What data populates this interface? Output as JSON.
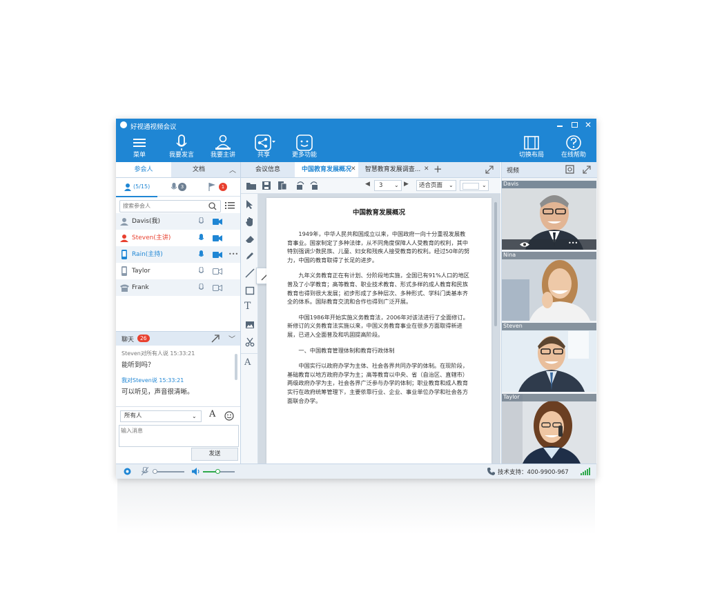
{
  "app": {
    "title": "好视通视频会议"
  },
  "toolbar": {
    "menu": "菜单",
    "speak": "我要发言",
    "host": "我要主讲",
    "share": "共享",
    "more": "更多功能",
    "layout": "切换布局",
    "help": "在线帮助"
  },
  "left": {
    "tabs": {
      "participants": "参会人",
      "docs": "文档"
    },
    "count": "(5/15)",
    "mic_badge": "3",
    "flag_badge": "1",
    "search": {
      "placeholder": "搜索参会人"
    },
    "participants": [
      {
        "name": "Davis(我)",
        "color": "#333333"
      },
      {
        "name": "Steven(主讲)",
        "color": "#e8402f"
      },
      {
        "name": "Rain(主持)",
        "color": "#1f86d4"
      },
      {
        "name": "Taylor",
        "color": "#333333"
      },
      {
        "name": "Frank",
        "color": "#333333"
      }
    ],
    "more": "•••"
  },
  "chat": {
    "title": "聊天",
    "badge": "26",
    "messages": [
      {
        "meta": "Steven对所有人说  15:33:21",
        "text": "能听到吗？"
      },
      {
        "meta": "我对Steven说  15:33:21",
        "text": "可以听见，声音很清晰。"
      }
    ],
    "target": "所有人",
    "input_placeholder": "输入消息",
    "send": "发送"
  },
  "doc": {
    "tabs": [
      "会议信息",
      "中国教育发展概况",
      "智慧教育发展调查..."
    ],
    "add": "+",
    "page": "3",
    "zoom": "适合页面",
    "title": "中国教育发展概况",
    "paragraphs": [
      "1949年，中华人民共和国成立以来，中国政府一向十分重视发展教育事业。国家制定了多种法律，从不同角度保障人人受教育的权利，其中特别强调少数民族、儿童、妇女和残疾人接受教育的权利。经过50年的努力，中国的教育取得了长足的进步。",
      "九年义务教育正在有计划、分阶段地实施，全国已有91%人口的地区普及了小学教育；高等教育、职业技术教育、形式多样的成人教育和民族教育也得到很大发展；初步形成了多种层次、多种形式、学科门类基本齐全的体系。国际教育交流和合作也得到广泛开展。",
      "中国1986年开始实施义务教育法，2006年对该法进行了全面修订。新修订的义务教育法实施以来，中国义务教育事业在很多方面取得新进展，已进入全面普及和巩固提高阶段。",
      "一、中国教育管理体制和教育行政体制",
      "中国实行以政府办学为主体、社会各界共同办学的体制。在现阶段，基础教育以地方政府办学为主；高等教育以中央、省（自治区、直辖市）两级政府办学为主，社会各界广泛参与办学的体制；职业教育和成人教育实行在政府统筹管理下，主要依靠行业、企业、事业单位办学和社会各方面联合办学。"
    ]
  },
  "video": {
    "title": "视频",
    "people": [
      "Davis",
      "Nina",
      "Steven",
      "Taylor"
    ],
    "more": "•••"
  },
  "status": {
    "support": "技术支持：400-9900-967"
  },
  "colors": {
    "accent": "#1f86d4",
    "red": "#e8402f"
  }
}
